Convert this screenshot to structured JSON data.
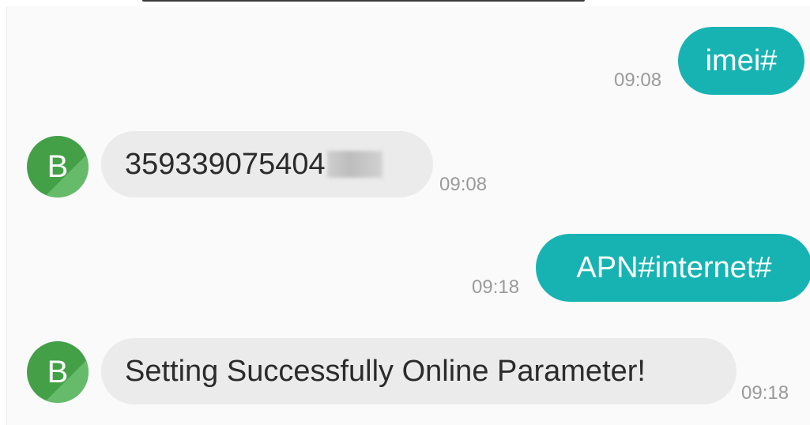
{
  "avatar_letter": "B",
  "messages": [
    {
      "direction": "outgoing",
      "text": "imei#",
      "time": "09:08"
    },
    {
      "direction": "incoming",
      "text": "359339075404",
      "time": "09:08",
      "redacted_suffix": true
    },
    {
      "direction": "outgoing",
      "text": "APN#internet#",
      "time": "09:18"
    },
    {
      "direction": "incoming",
      "text": "Setting Successfully Online Parameter!",
      "time": "09:18"
    }
  ],
  "colors": {
    "outgoing_bubble": "#17b3b3",
    "incoming_bubble": "#ebebeb",
    "avatar": "#43a047",
    "timestamp": "#9a9a9a"
  }
}
